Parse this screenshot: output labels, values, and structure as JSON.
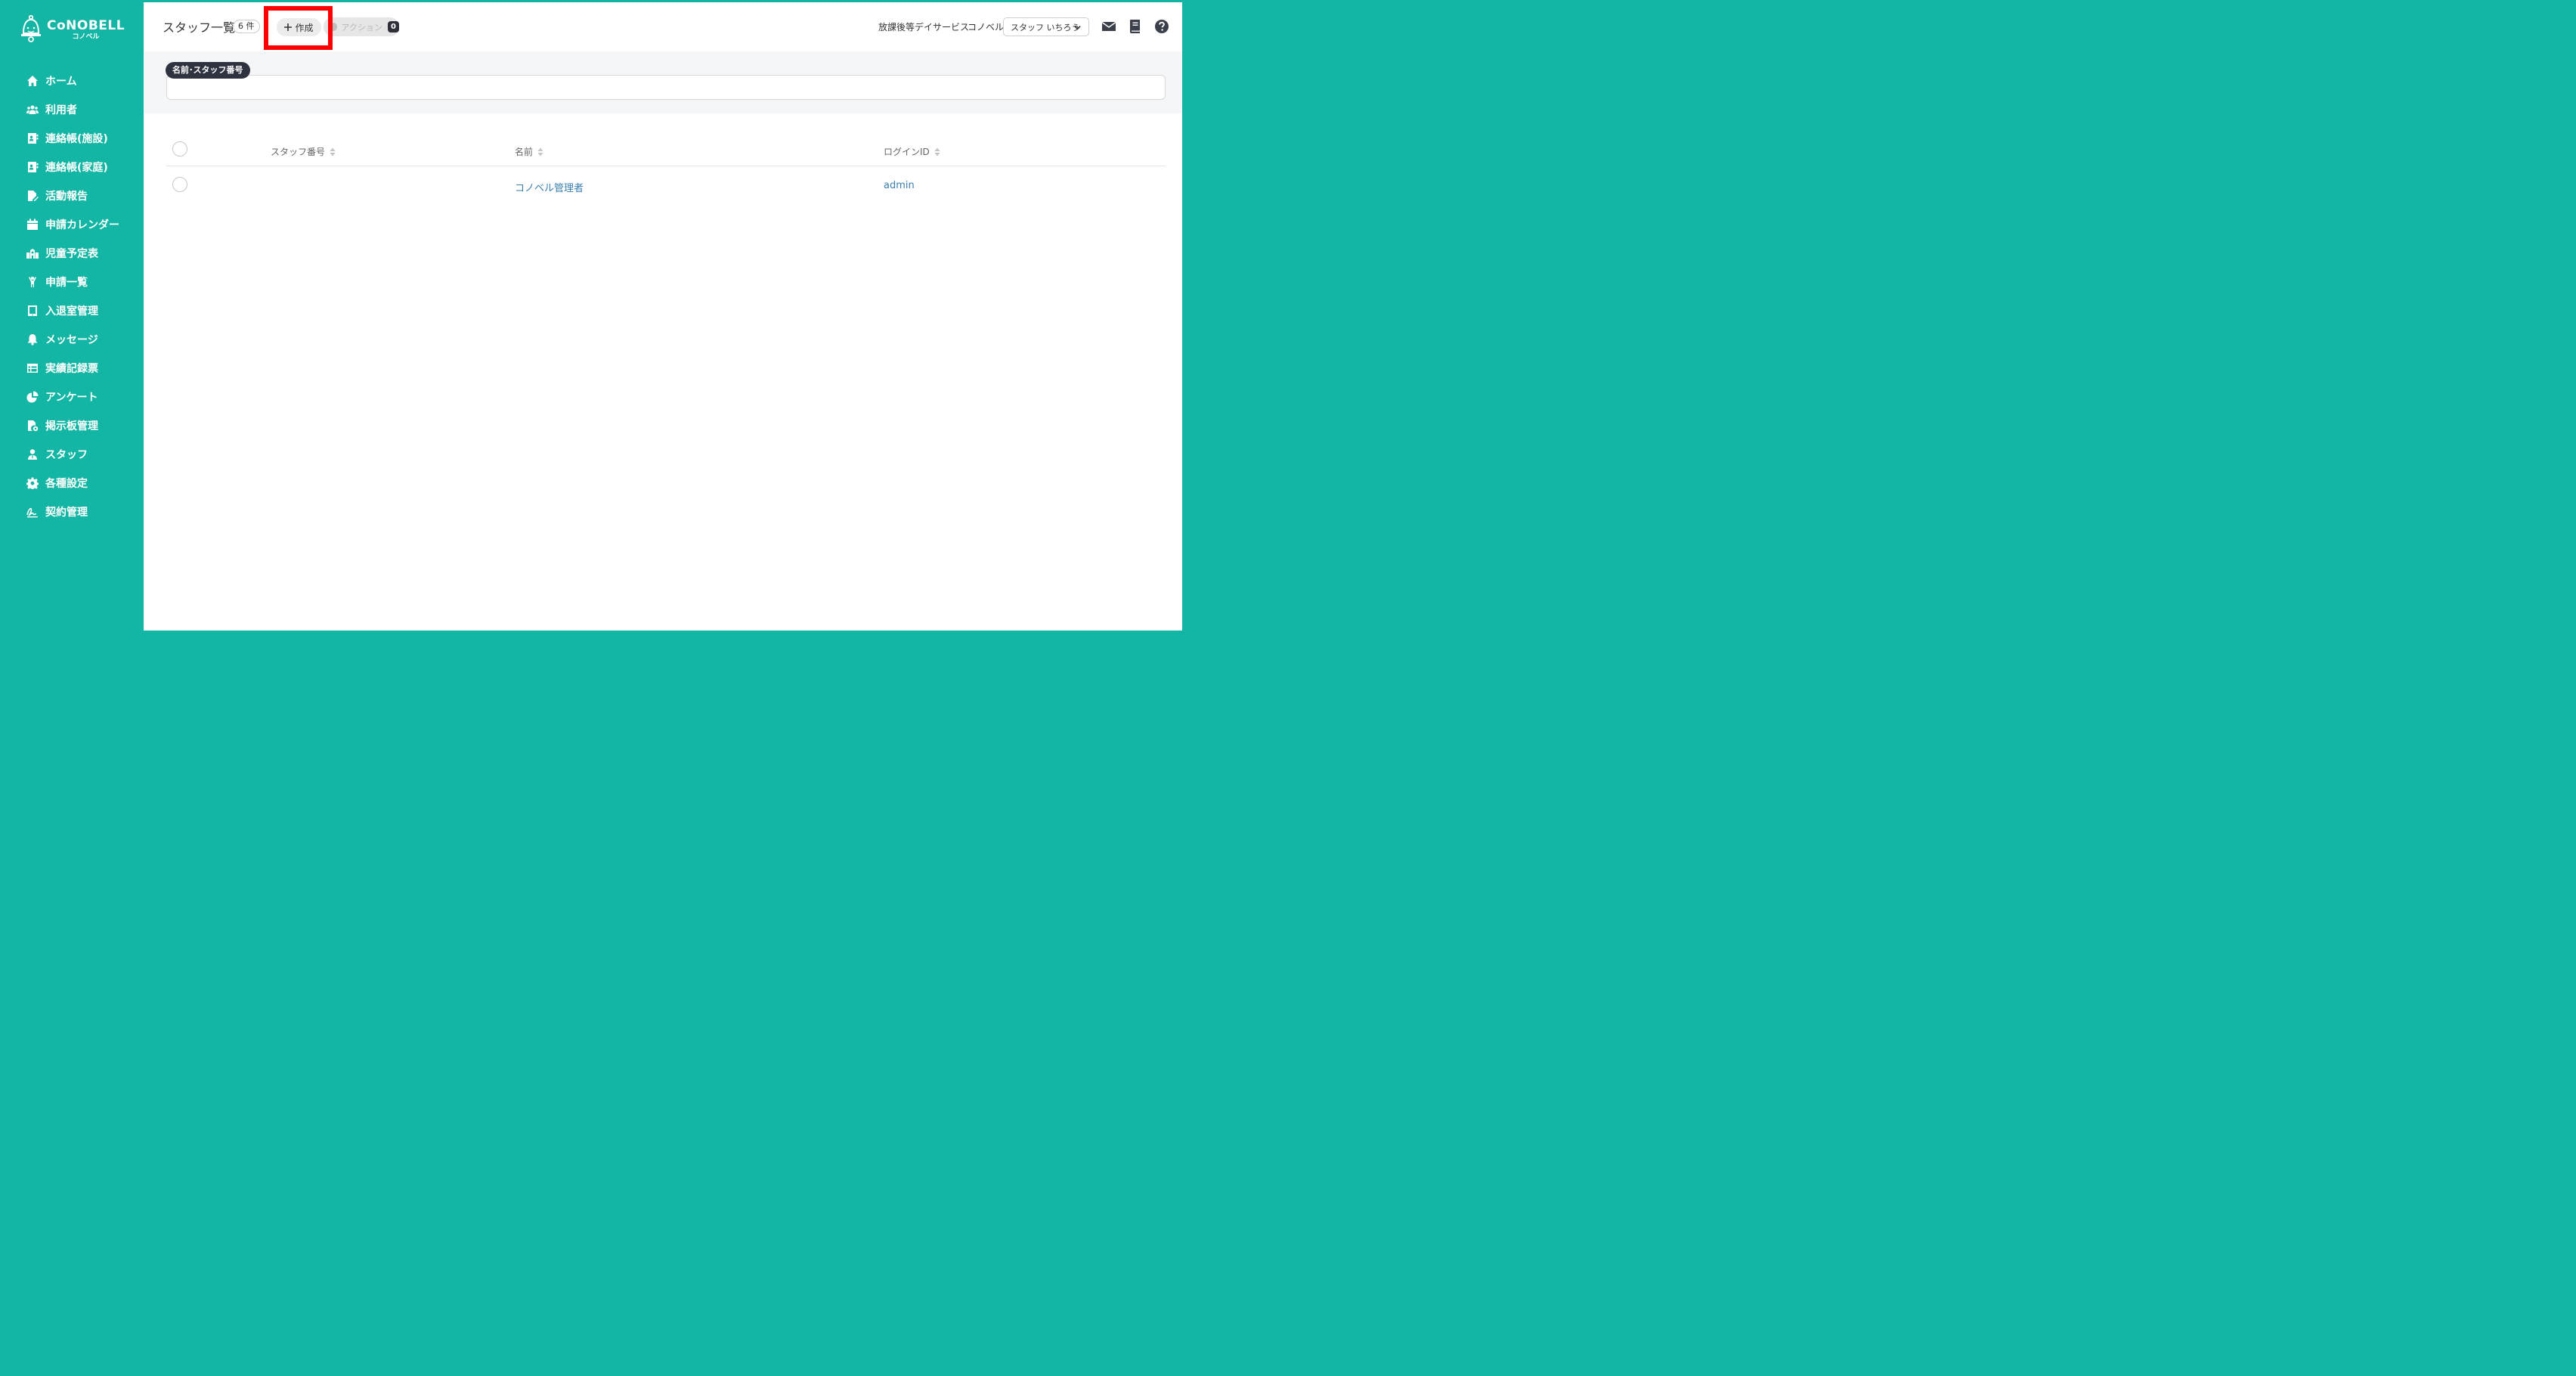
{
  "app": {
    "logo_text": "CoNOBELL",
    "logo_subtext": "コノベル"
  },
  "sidebar": {
    "items": [
      {
        "label": "ホーム",
        "icon": "home-icon"
      },
      {
        "label": "利用者",
        "icon": "users-icon"
      },
      {
        "label": "連絡帳(施設)",
        "icon": "contact-book-icon"
      },
      {
        "label": "連絡帳(家庭)",
        "icon": "contact-book-icon"
      },
      {
        "label": "活動報告",
        "icon": "file-edit-icon"
      },
      {
        "label": "申請カレンダー",
        "icon": "calendar-icon"
      },
      {
        "label": "児童予定表",
        "icon": "school-icon"
      },
      {
        "label": "申請一覧",
        "icon": "child-icon"
      },
      {
        "label": "入退室管理",
        "icon": "tablet-icon"
      },
      {
        "label": "メッセージ",
        "icon": "bell-icon"
      },
      {
        "label": "実績記録票",
        "icon": "table-icon"
      },
      {
        "label": "アンケート",
        "icon": "pie-chart-icon"
      },
      {
        "label": "掲示板管理",
        "icon": "file-settings-icon"
      },
      {
        "label": "スタッフ",
        "icon": "staff-icon"
      },
      {
        "label": "各種設定",
        "icon": "gear-icon"
      },
      {
        "label": "契約管理",
        "icon": "signature-icon"
      }
    ]
  },
  "header": {
    "title": "スタッフ一覧",
    "count": "6 件",
    "create_label": "作成",
    "action_label": "アクション",
    "action_count": "0",
    "facility_type": "放課後等デイサービス",
    "facility_name": "コノベル",
    "staff_select_value": "スタッフ いちろう"
  },
  "filter": {
    "chip_label": "名前･スタッフ番号",
    "value": ""
  },
  "table": {
    "columns": [
      "スタッフ番号",
      "名前",
      "ログインID"
    ],
    "rows": [
      {
        "staff_no": "",
        "name": "コノベル管理者",
        "login_id": "admin"
      }
    ]
  },
  "colors": {
    "brand": "#13b5a4",
    "link": "#3a7fae",
    "highlight": "#ff0000"
  }
}
